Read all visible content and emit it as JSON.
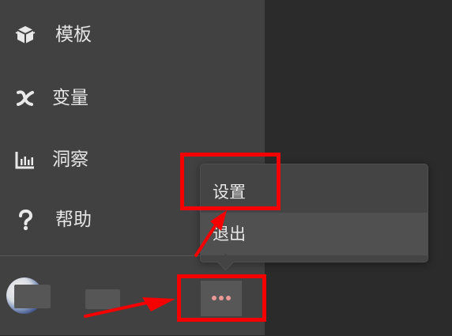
{
  "sidebar": {
    "items": [
      {
        "label": "模板",
        "icon": "box-icon"
      },
      {
        "label": "变量",
        "icon": "variable-x-icon"
      },
      {
        "label": "洞察",
        "icon": "bar-chart-icon"
      },
      {
        "label": "帮助",
        "icon": "question-icon"
      }
    ]
  },
  "user": {
    "avatar": "avatar-icon"
  },
  "more_button": {
    "icon": "more-horizontal-icon",
    "dot_color": "#e89796"
  },
  "popup": {
    "items": [
      {
        "label": "设置"
      },
      {
        "label": "退出"
      }
    ]
  },
  "colors": {
    "sidebar_bg": "#414141",
    "main_bg": "#2b2b2b",
    "popup_bg": "#444444",
    "popup_hover": "#505050",
    "annotation": "#f40000"
  }
}
